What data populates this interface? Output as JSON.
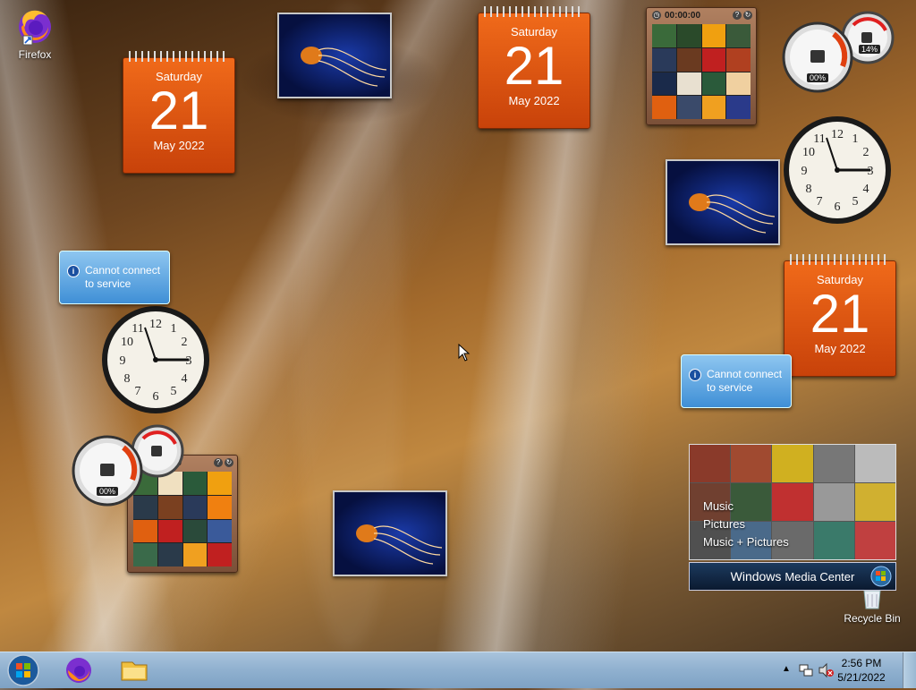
{
  "desktop": {
    "icons": [
      {
        "label": "Firefox"
      },
      {
        "label": "Recycle Bin"
      }
    ]
  },
  "calendars": [
    {
      "day": "Saturday",
      "date": "21",
      "month": "May 2022"
    },
    {
      "day": "Saturday",
      "date": "21",
      "month": "May 2022"
    },
    {
      "day": "Saturday",
      "date": "21",
      "month": "May 2022"
    }
  ],
  "weather": {
    "message_line1": "Cannot connect",
    "message_line2": "to service"
  },
  "puzzle": {
    "timer": "00:00:00"
  },
  "cpu_meter": {
    "cpu_percent": "00%",
    "memory_percent": "14%"
  },
  "media_center": {
    "menu_items": [
      "Music",
      "Pictures",
      "Music + Pictures"
    ],
    "brand_prefix": "Windows",
    "brand_suffix": "Media Center"
  },
  "taskbar": {
    "time": "2:56 PM",
    "date": "5/21/2022"
  },
  "colors": {
    "calendar": "#e35a12",
    "taskbar": "#8fb0cf",
    "slideshow_bg": "#0a1a6a"
  }
}
